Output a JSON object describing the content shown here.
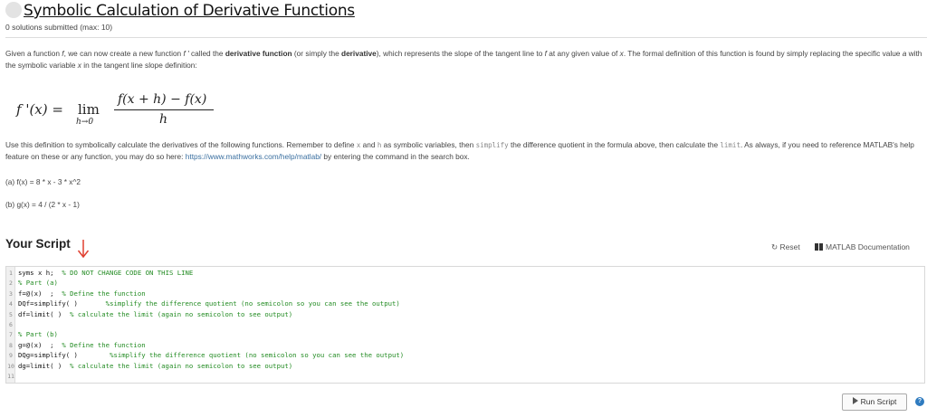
{
  "header": {
    "title": "Symbolic Calculation of Derivative Functions",
    "submissions": "0 solutions submitted (max: 10)"
  },
  "problem": {
    "p1_a": "Given a function ",
    "p1_f": "f",
    "p1_b": ", we can now create a new function ",
    "p1_fprime": "f '",
    "p1_c": " called the ",
    "p1_bold1": "derivative function",
    "p1_d": " (or simply the ",
    "p1_bold2": "derivative",
    "p1_e": "), which represents the slope of the tangent line to ",
    "p1_f2": "f",
    "p1_g": " at any given value of ",
    "p1_x": "x",
    "p1_h": ". The formal definition of this function is found by simply replacing the specific value ",
    "p1_a2": "a",
    "p1_i": " with the symbolic variable ",
    "p1_x2": "x",
    "p1_j": " in the tangent line slope definition:"
  },
  "formula": {
    "lhs": "f '(x) =",
    "lim": "lim",
    "sub": "h→0",
    "num": "f(x + h) − f(x)",
    "den": "h"
  },
  "instructions": {
    "a": "Use this definition to symbolically calculate the derivatives of the following functions. Remember to define ",
    "code_x": "x",
    "b": " and ",
    "code_h": "h",
    "c": " as symbolic variables, then ",
    "code_simplify": "simplify",
    "d": " the difference quotient in the formula above, then calculate the ",
    "code_limit": "limit",
    "e": ". As always, if you need to reference MATLAB's help feature on these or any function, you may do so here: ",
    "link": "https://www.mathworks.com/help/matlab/",
    "f": " by entering the command in the search box."
  },
  "parts": {
    "a": "(a) f(x) = 8 * x - 3 * x^2",
    "b": "(b) g(x) = 4 / (2 * x - 1)"
  },
  "script": {
    "title": "Your Script",
    "reset": "Reset",
    "matlab_doc": "MATLAB Documentation",
    "run": "Run Script",
    "help": "?"
  },
  "code_lines": [
    {
      "n": "1",
      "code": "syms x h;",
      "comment": "% DO NOT CHANGE CODE ON THIS LINE"
    },
    {
      "n": "2",
      "code": "",
      "comment": "% Part (a)"
    },
    {
      "n": "3",
      "code": "f=@(x)  ;",
      "comment": "% Define the function"
    },
    {
      "n": "4",
      "code": "DQf=simplify( )     ",
      "comment": "%simplify the difference quotient (no semicolon so you can see the output)"
    },
    {
      "n": "5",
      "code": "df=limit( )",
      "comment": "% calculate the limit (again no semicolon to see output)"
    },
    {
      "n": "6",
      "code": "",
      "comment": ""
    },
    {
      "n": "7",
      "code": "",
      "comment": "% Part (b)"
    },
    {
      "n": "8",
      "code": "g=@(x)  ;",
      "comment": "% Define the function"
    },
    {
      "n": "9",
      "code": "DQg=simplify( )      ",
      "comment": "%simplify the difference quotient (no semicolon so you can see the output)"
    },
    {
      "n": "10",
      "code": "dg=limit( )",
      "comment": "% calculate the limit (again no semicolon to see output)"
    },
    {
      "n": "11",
      "code": "",
      "comment": ""
    }
  ],
  "colors": {
    "comment": "#228b22",
    "link": "#3a6fa0",
    "arrow": "#e04030",
    "help": "#2f7bbf"
  }
}
